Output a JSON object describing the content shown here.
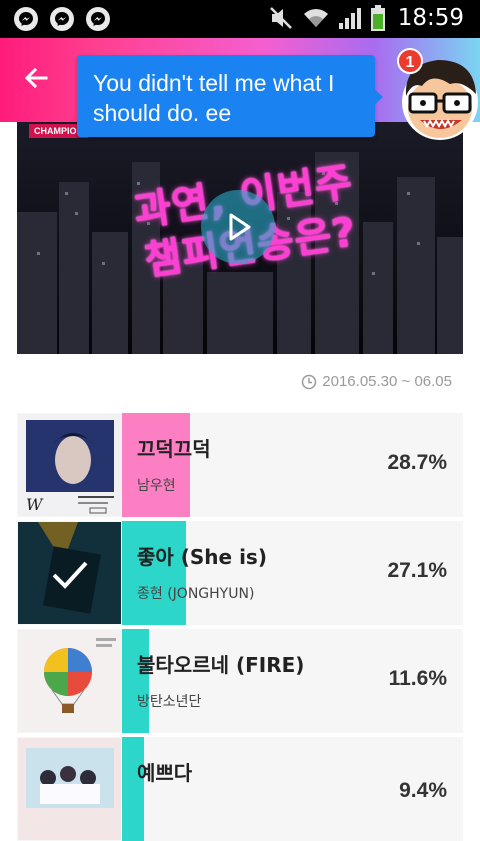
{
  "status_bar": {
    "time": "18:59",
    "left_icons": [
      "messenger-icon",
      "messenger-icon",
      "messenger-icon"
    ],
    "right_icons": [
      "mute-icon",
      "wifi-icon",
      "signal-icon",
      "battery-icon"
    ]
  },
  "header": {
    "back_icon": "arrow-left-icon",
    "gradient_colors": [
      "#ff1c7b",
      "#f45fd0",
      "#7bd4f2"
    ]
  },
  "toast": {
    "message": "You didn't tell me what I should do. ee"
  },
  "chat_head": {
    "badge_count": "1"
  },
  "video": {
    "tag": "CHAMPION",
    "overlay_text": "과연, 이번주 챔피언송은?",
    "play_icon": "play-icon"
  },
  "period": {
    "icon": "clock-icon",
    "text": "2016.05.30 ~ 06.05"
  },
  "rankings": [
    {
      "title": "끄덕끄덕",
      "artist": "남우현",
      "percent": "28.7%",
      "bar_color": "#fd7fc3",
      "fill": 0.287,
      "selected": false
    },
    {
      "title": "좋아 (She is)",
      "artist": "종현 (JONGHYUN)",
      "percent": "27.1%",
      "bar_color": "#2cd6c9",
      "fill": 0.271,
      "selected": true
    },
    {
      "title": "불타오르네 (FIRE)",
      "artist": "방탄소년단",
      "percent": "11.6%",
      "bar_color": "#2cd6c9",
      "fill": 0.116,
      "selected": false
    },
    {
      "title": "예쁘다",
      "artist": "",
      "percent": "9.4%",
      "bar_color": "#2cd6c9",
      "fill": 0.094,
      "selected": false
    }
  ],
  "colors": {
    "pink_bar": "#fd7fc3",
    "teal_bar": "#2cd6c9",
    "toast_blue": "#1b82f2"
  }
}
